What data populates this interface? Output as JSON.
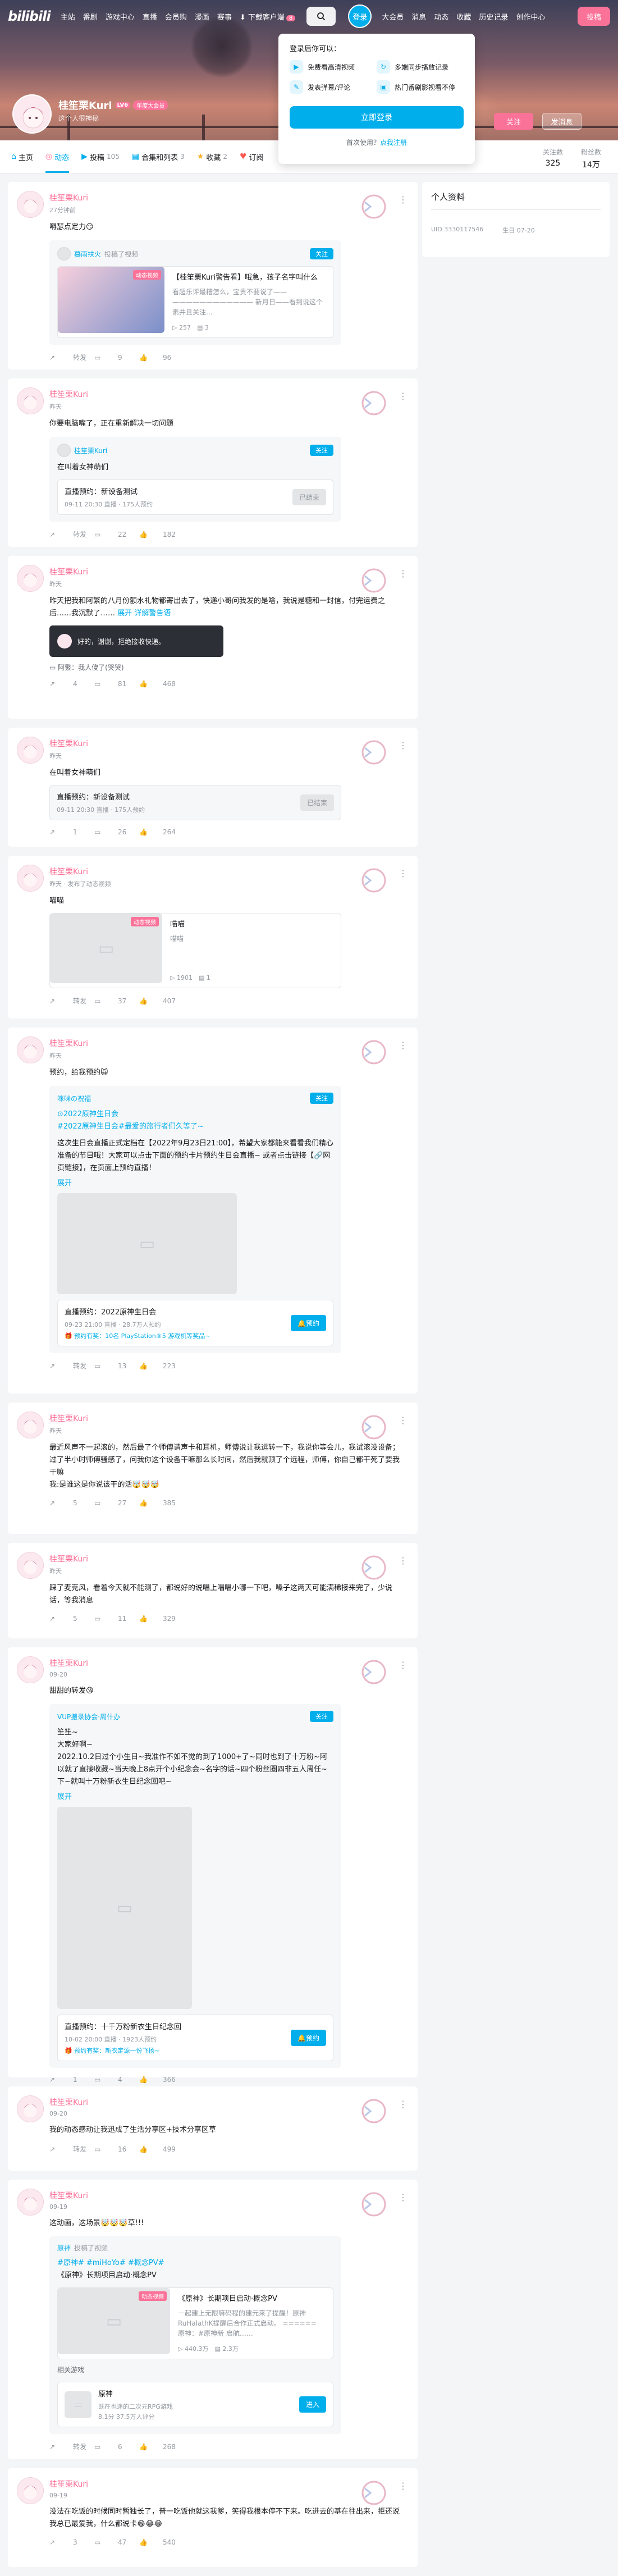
{
  "nav": {
    "logo": "bilibili",
    "links": [
      "主站",
      "番剧",
      "游戏中心",
      "直播",
      "会员购",
      "漫画",
      "赛事"
    ],
    "download": "下载客户端",
    "download_badge": "8",
    "login": "登录",
    "right_links": [
      "大会员",
      "消息",
      "动态",
      "收藏",
      "历史记录",
      "创作中心"
    ],
    "contribute": "投稿"
  },
  "popover": {
    "title": "登录后你可以：",
    "items": [
      "免费看高清视频",
      "多端同步播放记录",
      "发表弹幕/评论",
      "热门番剧影视看不停"
    ],
    "button": "立即登录",
    "footer_prefix": "首次使用？",
    "footer_link": "点我注册"
  },
  "profile": {
    "name": "桂笙栗Kuri",
    "level": "LV6",
    "vip": "年度大会员",
    "sign": "这个人很神秘",
    "follow": "关注",
    "message": "发消息"
  },
  "tabs": [
    {
      "icon": "⌂",
      "label": "主页",
      "count": ""
    },
    {
      "icon": "◎",
      "label": "动态",
      "count": ""
    },
    {
      "icon": "▶",
      "label": "投稿",
      "count": "105"
    },
    {
      "icon": "▦",
      "label": "合集和列表",
      "count": "3"
    },
    {
      "icon": "★",
      "label": "收藏",
      "count": "2"
    },
    {
      "icon": "♥",
      "label": "订阅",
      "count": ""
    }
  ],
  "stats": [
    {
      "label": "关注数",
      "value": "325"
    },
    {
      "label": "粉丝数",
      "value": "14万"
    }
  ],
  "sidebar": {
    "title": "个人资料",
    "uid_label": "UID",
    "uid": "3330117546",
    "birthday_label": "生日",
    "birthday": "07-20"
  },
  "posts": [
    {
      "author": "桂笙栗Kuri",
      "time": "27分钟前",
      "text": "嘚瑟点定力😏",
      "repost": {
        "name": "暮雨扶火",
        "action": "投稿了视频",
        "follow": "关注"
      },
      "video": {
        "title": "【桂笙栗Kuri警告看】哦急，孩子名字叫什么",
        "desc": "看超乐评最糟怎么，宝贵不要说了——\n———————————— 新月日——看到说这个素并且关注...",
        "plays": "257",
        "danmaku": "3",
        "tag": "动态视频"
      },
      "actions": [
        "转发",
        "9",
        "96"
      ]
    },
    {
      "author": "桂笙栗Kuri",
      "time": "昨天",
      "text": "你要电脑嘴了，正在重新解决一切问题",
      "repost": {
        "name": "桂笙栗Kuri",
        "action": "",
        "follow": "关注"
      },
      "inner_text": "在叫着女神萌们",
      "box": {
        "title": "直播预约：新设备测试",
        "sub": "09-11 20:30 直播 · 175人预约",
        "btn": "已结束"
      },
      "actions": [
        "转发",
        "22",
        "182"
      ]
    },
    {
      "author": "桂笙栗Kuri",
      "time": "昨天",
      "text": "昨天把我和阿繁的八月份额水礼物都寄出去了，快递小哥问我发的是啥，我说是糖和一封信，付完运费之后……我沉默了……",
      "more": "展开",
      "tag_text": "详解警告语",
      "dark": {
        "text": "好的，谢谢，拒绝接收快递。"
      },
      "comment": "阿繁：我人傻了(哭哭)",
      "actions": [
        "4",
        "81",
        "468"
      ]
    },
    {
      "author": "桂笙栗Kuri",
      "time": "昨天",
      "text": "在叫着女神萌们",
      "box": {
        "title": "直播预约：新设备测试",
        "sub": "09-11 20:30 直播 · 175人预约",
        "btn": "已结束"
      },
      "actions": [
        "1",
        "26",
        "264"
      ]
    },
    {
      "author": "桂笙栗Kuri",
      "time": "昨天 · 发布了动态视频",
      "text": "喵喵",
      "video": {
        "title": "喵喵",
        "desc": "喵喵",
        "plays": "1901",
        "danmaku": "1",
        "tag": "动态视频"
      },
      "actions": [
        "转发",
        "37",
        "407"
      ]
    },
    {
      "author": "桂笙栗Kuri",
      "time": "昨天",
      "text": "预约，给我预约🙀",
      "repost": {
        "name": "咪咪の祝福",
        "action": "",
        "follow": "关注"
      },
      "inner_tags": [
        "2022原神生日会",
        "#2022原神生日会#最爱的旅行者们久等了~"
      ],
      "inner_text": "这次生日会直播正式定档在【2022年9月23日21:00】，希望大家都能来看看我们精心准备的节目哦！大家可以点击下面的预约卡片预约生日会直播~ 或者点击链接【🔗网页链接】，在页面上预约直播！",
      "inner_link": "展开",
      "box": {
        "title": "直播预约：2022原神生日会",
        "sub": "09-23 21:00 直播 · 28.7万人预约",
        "sub2": "🎁 预约有奖：10名 PlayStation®5 游戏机等奖品~",
        "btn": "预约"
      },
      "actions": [
        "转发",
        "13",
        "223"
      ]
    },
    {
      "author": "桂笙栗Kuri",
      "time": "昨天",
      "text": "最近风声不一起滚的，然后最了个师傅请声卡和耳机，师傅说让我运转一下，我说你等会儿，我试滚没设备；过了半小时师傅骚感了，问我你这个设备干嘛那么长时间，然后我就顶了个远程，师傅，你自己都干死了要我干嘛\n我:是谁这是你说该干的活🤯🤯🤯",
      "actions": [
        "5",
        "27",
        "385"
      ]
    },
    {
      "author": "桂笙栗Kuri",
      "time": "昨天",
      "text": "踩了麦克风，看着今天就不能测了，都说好的说唱上唱唱小哪一下吧，嗓子这两天可能满稀接来完了，少说话，等我消息",
      "actions": [
        "5",
        "11",
        "329"
      ]
    },
    {
      "author": "桂笙栗Kuri",
      "time": "09-20",
      "text": "甜甜的转发😘",
      "repost": {
        "name": "VUP搬录协会·周什办",
        "action": "",
        "follow": "关注"
      },
      "inner_text": "笙笙~\n大家好啊~\n2022.10.2日过个小生日~我准作不如不觉的到了1000+了~同时也到了十万粉~阿以就了直接收藏~当天晚上8点开个小纪念会~名字的话~四个粉丝圈四非五人周任~下~就叫十万粉新衣生日纪念回吧~",
      "inner_link": "展开",
      "box": {
        "title": "直播预约：十千万粉新衣生日纪念回",
        "sub": "10-02 20:00 直播 · 1923人预约",
        "sub2": "🎁 预约有奖：新衣定源一份飞扬~",
        "btn": "预约"
      },
      "actions": [
        "1",
        "4",
        "366"
      ]
    },
    {
      "author": "桂笙栗Kuri",
      "time": "09-20",
      "text": "我的动态感动让我迅成了生活分享区+技术分享区草",
      "actions": [
        "转发",
        "16",
        "499"
      ]
    },
    {
      "author": "桂笙栗Kuri",
      "time": "09-19",
      "text": "这动画，这场景🤯🤯🤯草!!!",
      "repost": {
        "name": "原神",
        "action": "投稿了视频",
        "follow": ""
      },
      "inner_tags": [
        "#原神# #miHoYo# #概念PV#",
        "《原神》长期项目启动·概念PV"
      ],
      "video": {
        "title": "《原神》长期项目启动·概念PV",
        "desc": "一起建上无限嘛码程的建元来了提醒！原神RuHalathK提醒后合作正式启动。 ====== 原神：#原神新 启航……",
        "plays": "440.3万",
        "danmaku": "2.3万",
        "tag": "动态视频"
      },
      "related_label": "相关游戏",
      "game": {
        "title": "原神",
        "sub": "既在也迷的二次元RPG游戏",
        "sub2": "8.1分 37.5万人评分",
        "btn": "进入"
      },
      "actions": [
        "转发",
        "6",
        "268"
      ]
    },
    {
      "author": "桂笙栗Kuri",
      "time": "09-19",
      "text": "没法在吃饭的时候同时暂独长了，普一吃饭他就这我爹，笑得我根本停不下来。吃进去的基在往出来，拒还说我总已最爱我，什么都说卡😂😂😂",
      "actions": [
        "3",
        "47",
        "540"
      ]
    }
  ]
}
